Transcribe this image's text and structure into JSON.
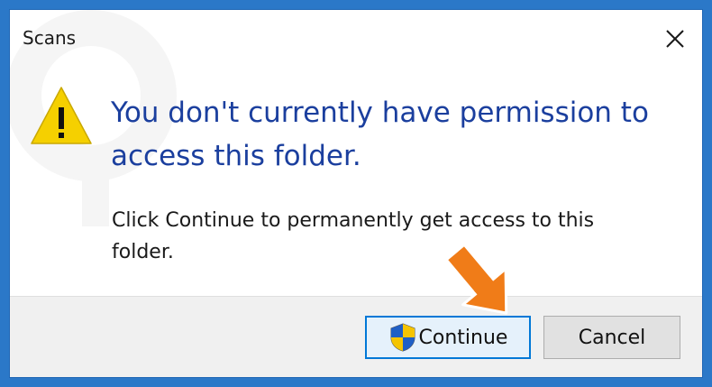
{
  "window": {
    "title": "Scans"
  },
  "message": {
    "heading": "You don't currently have permission to access this folder.",
    "description": "Click Continue to permanently get access to this folder."
  },
  "buttons": {
    "continue_label": "Continue",
    "cancel_label": "Cancel"
  },
  "icons": {
    "close": "close-icon",
    "warning": "warning-icon",
    "uac_shield": "uac-shield-icon",
    "annotation_arrow": "arrow-icon"
  },
  "colors": {
    "frame_border": "#2b78c8",
    "heading": "#1b3f9e",
    "default_button_border": "#0078d7",
    "warning_yellow": "#f5d000",
    "annotation_arrow": "#f07c18"
  }
}
